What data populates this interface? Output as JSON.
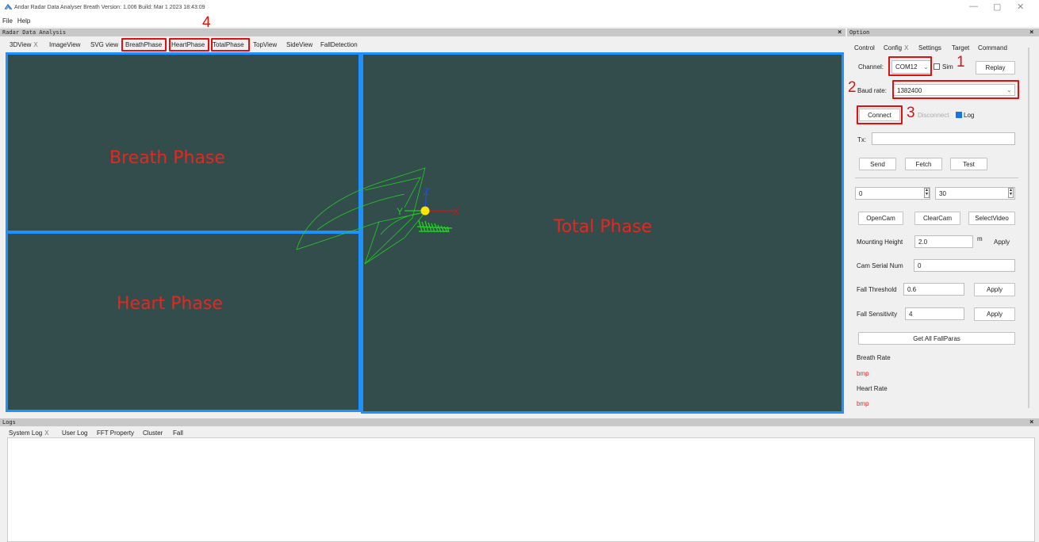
{
  "window": {
    "title": "Andar Radar Data Analyser Breath Version: 1.006 Build: Mar  1 2023 18:43:09",
    "minimize": "—",
    "maximize": "▢",
    "close": "✕"
  },
  "menu": [
    "File",
    "Help"
  ],
  "analysis_dock": {
    "title": "Radar Data Analysis",
    "close": "×",
    "tabs": [
      "3DView",
      "ImageView",
      "SVG view",
      "BreathPhase",
      "HeartPhase",
      "TotalPhase",
      "TopView",
      "SideView",
      "FallDetection"
    ],
    "tab_close": "X",
    "annotation": "4"
  },
  "panels": {
    "breath": "Breath Phase",
    "heart": "Heart Phase",
    "total": "Total Phase"
  },
  "axes3d": {
    "z": "Z",
    "y": "Y",
    "x": "X"
  },
  "option_dock": {
    "title": "Option",
    "close": "×",
    "tabs": [
      "Control",
      "Config",
      "Settings",
      "Target",
      "Command"
    ],
    "tab_close": "X",
    "channel_label": "Channel:",
    "channel_value": "COM12",
    "sim_label": "Sim",
    "sim_checked": false,
    "replay": "Replay",
    "baud_label": "Baud rate:",
    "baud_value": "1382400",
    "connect": "Connect",
    "disconnect": "Disconnect",
    "log_label": "Log",
    "log_checked": true,
    "tx_label": "Tx:",
    "tx_value": "",
    "send": "Send",
    "fetch": "Fetch",
    "test": "Test",
    "spin1": "0",
    "spin2": "30",
    "open_cam": "OpenCam",
    "clear_cam": "ClearCam",
    "select_video": "SelectVideo",
    "mounting_label": "Mounting Height",
    "mounting_value": "2.0",
    "mounting_unit": "m",
    "apply": "Apply",
    "cam_serial_label": "Cam Serial Num",
    "cam_serial_value": "0",
    "fall_threshold_label": "Fall Threshold",
    "fall_threshold_value": "0.6",
    "fall_sensitivity_label": "Fall Sensitivity",
    "fall_sensitivity_value": "4",
    "get_all": "Get All FallParas",
    "breath_rate_label": "Breath Rate",
    "breath_rate_value": "bmp",
    "heart_rate_label": "Heart Rate",
    "heart_rate_value": "bmp",
    "annotations": [
      "1",
      "2",
      "3"
    ]
  },
  "logs_dock": {
    "title": "Logs",
    "close": "×",
    "tabs": [
      "System Log",
      "User Log",
      "FFT Property",
      "Cluster",
      "Fall"
    ],
    "tab_close": "X"
  },
  "colors": {
    "panel_bg": "#334c4c",
    "panel_border": "#1e90ff",
    "annotation_red": "#e01010",
    "plot_green": "#1fd01f"
  }
}
